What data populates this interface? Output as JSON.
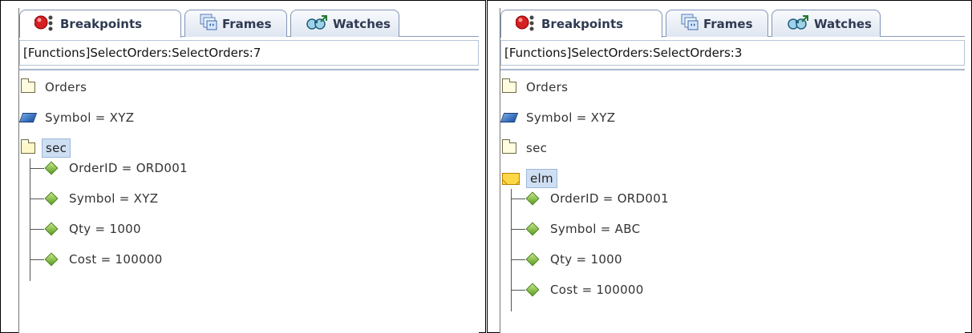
{
  "tabs": [
    "Breakpoints",
    "Frames",
    "Watches"
  ],
  "left": {
    "path": "[Functions]SelectOrders:SelectOrders:7",
    "nodes": [
      "Orders",
      "Symbol = XYZ",
      "sec"
    ],
    "selected": "sec",
    "children": [
      "OrderID = ORD001",
      "Symbol = XYZ",
      "Qty = 1000",
      "Cost = 100000"
    ],
    "icons": [
      "folder-icon",
      "cube-icon",
      "open-folder-icon"
    ]
  },
  "right": {
    "path": "[Functions]SelectOrders:SelectOrders:3",
    "nodes": [
      "Orders",
      "Symbol = XYZ",
      "sec",
      "elm"
    ],
    "selected": "elm",
    "children": [
      "OrderID = ORD001",
      "Symbol = ABC",
      "Qty = 1000",
      "Cost = 100000"
    ],
    "icons": [
      "folder-icon",
      "cube-icon",
      "folder-icon",
      "envelope-icon"
    ]
  },
  "colors": {
    "tab_text": "#2f3a52",
    "selection": "#cfdff3"
  }
}
